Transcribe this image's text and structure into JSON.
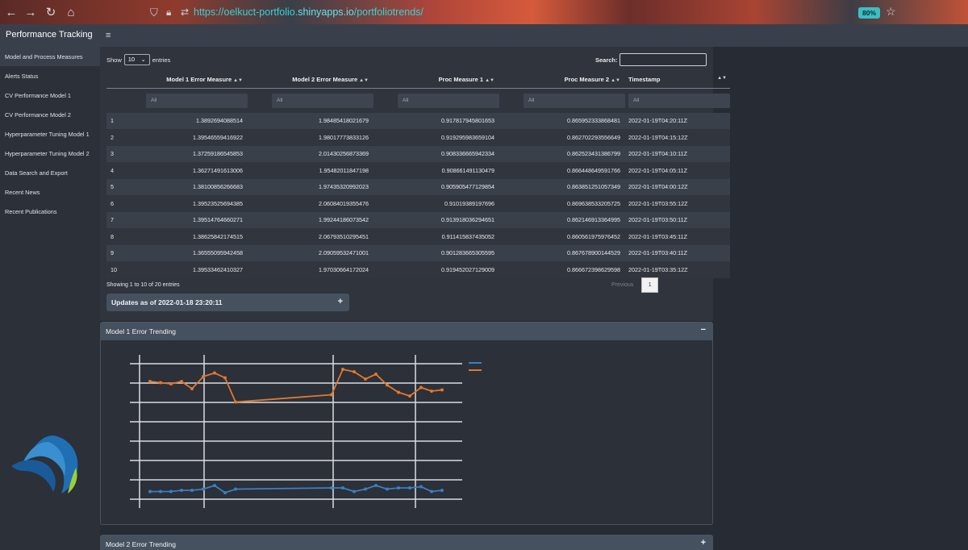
{
  "browser": {
    "url_prefix": "https://oelkuct-portfolio.",
    "url_host": "shinyapps.io",
    "url_path": "/portfoliotrends/",
    "zoom": "80%"
  },
  "app": {
    "title": "Performance Tracking"
  },
  "sidebar": {
    "items": [
      {
        "label": "Model and Process Measures",
        "active": true
      },
      {
        "label": "Alerts Status"
      },
      {
        "label": "CV Performance Model 1"
      },
      {
        "label": "CV Performance Model 2"
      },
      {
        "label": "Hyperparameter Tuning Model 1"
      },
      {
        "label": "Hyperparameter Tuning Model 2"
      },
      {
        "label": "Data Search and Export"
      },
      {
        "label": "Recent News"
      },
      {
        "label": "Recent Publications"
      }
    ]
  },
  "table": {
    "show_label": "Show",
    "length_value": "10",
    "entries_label": "entries",
    "search_label": "Search:",
    "columns": [
      "Model 1 Error Measure",
      "Model 2 Error Measure",
      "Proc Measure 1",
      "Proc Measure 2",
      "Timestamp"
    ],
    "filter_placeholder": "All",
    "rows": [
      [
        "1",
        "1.3892694088514",
        "1.98485418021679",
        "0.917817945801653",
        "0.865952333868481",
        "2022-01-19T04:20:11Z"
      ],
      [
        "2",
        "1.39546559416922",
        "1.98017773833126",
        "0.919295983659104",
        "0.862702293556649",
        "2022-01-19T04:15:12Z"
      ],
      [
        "3",
        "1.37259186545853",
        "2.01430256873369",
        "0.908336665942334",
        "0.862523431386799",
        "2022-01-19T04:10:11Z"
      ],
      [
        "4",
        "1.36271491613006",
        "1.95482011847198",
        "0.908661491130479",
        "0.866448649591766",
        "2022-01-19T04:05:11Z"
      ],
      [
        "5",
        "1.38100856266683",
        "1.97435320992023",
        "0.905905477129854",
        "0.863851251057349",
        "2022-01-19T04:00:12Z"
      ],
      [
        "6",
        "1.39523525694385",
        "2.06084019355476",
        "0.91019389197696",
        "0.869638533205725",
        "2022-01-19T03:55:12Z"
      ],
      [
        "7",
        "1.39514764660271",
        "1.99244186073542",
        "0.913918036294651",
        "0.862146913364995",
        "2022-01-19T03:50:11Z"
      ],
      [
        "8",
        "1.38625842174515",
        "2.06793510295451",
        "0.911415837435052",
        "0.860561975976452",
        "2022-01-19T03:45:11Z"
      ],
      [
        "9",
        "1.36555095942458",
        "2.09059532471001",
        "0.901283665305595",
        "0.867678900144529",
        "2022-01-19T03:40:11Z"
      ],
      [
        "10",
        "1.39533462410327",
        "1.97030664172024",
        "0.919452027129009",
        "0.866672398629598",
        "2022-01-19T03:35:12Z"
      ]
    ],
    "info": "Showing 1 to 10 of 20 entries",
    "pager": {
      "previous": "Previous",
      "page": "1"
    }
  },
  "updates": {
    "label": "Updates as of 2022-01-18 23:20:11",
    "toggle": "+"
  },
  "model1_card": {
    "title": "Model 1 Error Trending",
    "toggle": "−"
  },
  "model2_card": {
    "title": "Model 2 Error Trending",
    "toggle": "+"
  },
  "colors": {
    "series_blue": "#3b7fc4",
    "series_orange": "#e0782e",
    "accent_teal": "#35d2d6"
  },
  "chart_data": {
    "type": "line",
    "title": "",
    "xlabel": "",
    "ylabel": "",
    "grid": true,
    "legend_placement": "top-right",
    "series": [
      {
        "color": "#3b7fc4",
        "values": [
          0.07,
          0.07,
          0.07,
          0.08,
          0.08,
          0.09,
          0.12,
          0.06,
          0.09,
          0.1,
          0.1,
          0.07,
          0.09,
          0.12,
          0.09,
          0.1,
          0.1,
          0.11,
          0.07,
          0.08,
          0.1,
          0.1
        ]
      },
      {
        "color": "#e0782e",
        "values": [
          0.98,
          0.97,
          0.96,
          0.98,
          0.92,
          1.02,
          1.05,
          1.01,
          0.81,
          0.87,
          1.08,
          1.06,
          1.0,
          1.04,
          0.95,
          0.89,
          0.86,
          0.93,
          0.9,
          0.91,
          0.92,
          0.92
        ]
      }
    ],
    "ylim": [
      0,
      1.2
    ]
  }
}
